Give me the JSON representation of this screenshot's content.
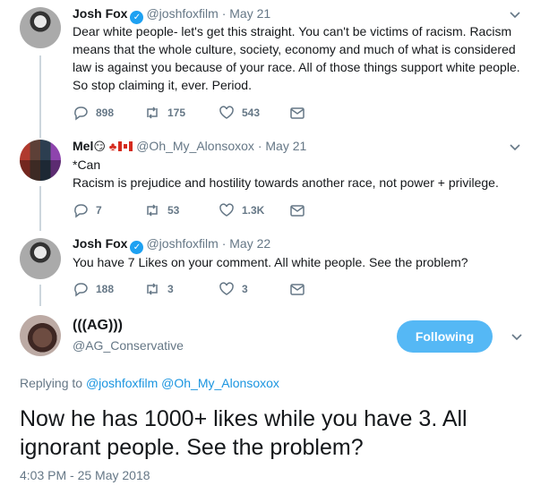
{
  "tweets": [
    {
      "name": "Josh Fox",
      "handle": "@joshfoxfilm",
      "date": "May 21",
      "text": "Dear white people- let's get this straight. You can't be victims of racism.  Racism means that the whole culture, society, economy and much of what is considered law is against you because of your race. All of those things support white people. So stop claiming it, ever. Period.",
      "replies": "898",
      "retweets": "175",
      "likes": "543"
    },
    {
      "name": "Mel",
      "name_emoji": "😏",
      "handle": "@Oh_My_Alonsoxox",
      "date": "May 21",
      "text_line1": "*Can",
      "text_line2": "Racism is prejudice and hostility towards another race, not power + privilege.",
      "replies": "7",
      "retweets": "53",
      "likes": "1.3K"
    },
    {
      "name": "Josh Fox",
      "handle": "@joshfoxfilm",
      "date": "May 22",
      "text": "You have 7 Likes on your comment.  All white people. See the problem?",
      "replies": "188",
      "retweets": "3",
      "likes": "3"
    }
  ],
  "main_tweet": {
    "name": "(((AG)))",
    "handle": "@AG_Conservative",
    "follow_label": "Following",
    "replying_prefix": "Replying to",
    "mention1": "@joshfoxfilm",
    "mention2": "@Oh_My_Alonsoxox",
    "text": "Now he has 1000+ likes while you have 3. All ignorant people. See the problem?",
    "timestamp": "4:03 PM - 25 May 2018"
  },
  "separator": "·",
  "colors": {
    "accent": "#1da1f2",
    "muted": "#657786",
    "text": "#14171a",
    "line": "#ccd6dd"
  },
  "icons": [
    "verified-icon",
    "reply-icon",
    "retweet-icon",
    "like-icon",
    "dm-icon",
    "chevron-down-icon"
  ]
}
